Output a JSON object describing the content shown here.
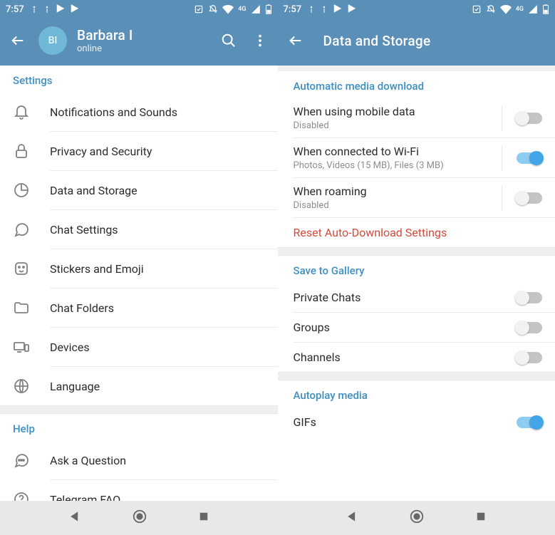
{
  "statusbar": {
    "time": "7:57",
    "net_label": "4G"
  },
  "left": {
    "user_initials": "BI",
    "user_name": "Barbara I",
    "user_status": "online",
    "section_settings": "Settings",
    "rows": {
      "notifications": "Notifications and Sounds",
      "privacy": "Privacy and Security",
      "data": "Data and Storage",
      "chat": "Chat Settings",
      "stickers": "Stickers and Emoji",
      "folders": "Chat Folders",
      "devices": "Devices",
      "language": "Language"
    },
    "section_help": "Help",
    "help_rows": {
      "ask": "Ask a Question",
      "faq": "Telegram FAQ"
    }
  },
  "right": {
    "title": "Data and Storage",
    "section_auto": "Automatic media download",
    "mobile": {
      "title": "When using mobile data",
      "sub": "Disabled",
      "on": false
    },
    "wifi": {
      "title": "When connected to Wi-Fi",
      "sub": "Photos, Videos (15 MB), Files (3 MB)",
      "on": true
    },
    "roaming": {
      "title": "When roaming",
      "sub": "Disabled",
      "on": false
    },
    "reset": "Reset Auto-Download Settings",
    "section_gallery": "Save to Gallery",
    "private_chats": {
      "title": "Private Chats",
      "on": false
    },
    "groups": {
      "title": "Groups",
      "on": false
    },
    "channels": {
      "title": "Channels",
      "on": false
    },
    "section_autoplay": "Autoplay media",
    "gifs": {
      "title": "GIFs",
      "on": true
    }
  }
}
